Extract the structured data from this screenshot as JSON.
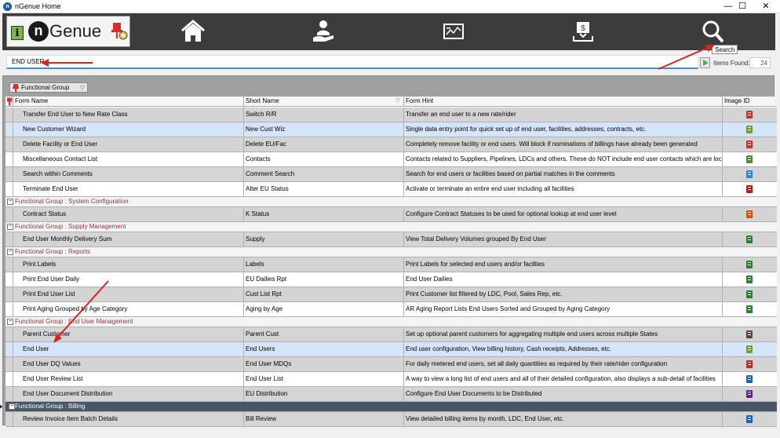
{
  "window": {
    "title": "nGenue Home",
    "minimize": "—",
    "maximize": "☐",
    "close": "✕"
  },
  "brand": {
    "info": "i",
    "logo_mark": "n",
    "logo_text": "Genue"
  },
  "nav": [
    {
      "name": "home-icon"
    },
    {
      "name": "customer-service-icon"
    },
    {
      "name": "dashboard-icon"
    },
    {
      "name": "billing-icon"
    },
    {
      "name": "search-icon"
    }
  ],
  "tooltip": "Search",
  "search": {
    "value": "END USER",
    "items_label": "Items Found:",
    "items_count": "24"
  },
  "group_chip": {
    "label": "Functional Group"
  },
  "columns": {
    "form_name": "Form Name",
    "short_name": "Short Name",
    "form_hint": "Form Hint",
    "image_id": "Image ID"
  },
  "rows": [
    {
      "type": "data",
      "form": "Transfer End User to New Rate Class",
      "short": "Switch R/R",
      "hint": "Transfer an end user to a new rate/rider",
      "icon": "transfer-icon",
      "color": "#c0392b"
    },
    {
      "type": "data",
      "form": "New Customer Wizard",
      "short": "New Cust Wiz",
      "hint": "Single data entry point for quick set up of end user, facilities, addresses, contracts, etc.",
      "icon": "users-icon",
      "color": "#7a9a3a"
    },
    {
      "type": "data",
      "form": "Delete Facility or End User",
      "short": "Delete EU/Fac",
      "hint": "Completely remove facility or end users. Will block if nominations of billings have already been generated",
      "icon": "trash-icon",
      "color": "#d32f2f"
    },
    {
      "type": "data",
      "form": "Miscellaneous Contact List",
      "short": "Contacts",
      "hint": "Contacts related to Suppliers, Pipelines, LDCs and others. These do NOT include end user contacts which are locate",
      "icon": "contacts-icon",
      "color": "#558b2f"
    },
    {
      "type": "data",
      "form": "Search within Comments",
      "short": "Comment Search",
      "hint": "Search for end users or facilities based on partial matches in the comments",
      "icon": "magnifier-icon",
      "color": "#1e88e5"
    },
    {
      "type": "data",
      "form": "Terminate End User",
      "short": "Alter EU Status",
      "hint": "Activate or terminate an entire end user including all facilities",
      "icon": "terminate-icon",
      "color": "#b71c1c"
    },
    {
      "type": "group",
      "label": "Functional Group : System Configuration"
    },
    {
      "type": "data",
      "form": "Contract Status",
      "short": "K Status",
      "hint": "Configure Contract Statuses to be used for optional lookup at end user level",
      "icon": "contract-icon",
      "color": "#e65100"
    },
    {
      "type": "group",
      "label": "Functional Group : Supply Management"
    },
    {
      "type": "data",
      "form": "End User Monthly Delivery Sum",
      "short": "Supply",
      "hint": "View Total Delivery Volumes grouped By End User",
      "icon": "report-icon",
      "color": "#2e7d32"
    },
    {
      "type": "group",
      "label": "Functional Group : Reports"
    },
    {
      "type": "data",
      "form": "Print Labels",
      "short": "Labels",
      "hint": "Print Labels for selected end users and/or facilties",
      "icon": "report-icon",
      "color": "#2e7d32"
    },
    {
      "type": "data",
      "form": "Print End User Daily",
      "short": "EU Dailies Rpt",
      "hint": "End User Dailies",
      "icon": "report-icon",
      "color": "#2e7d32"
    },
    {
      "type": "data",
      "form": "Print End User List",
      "short": "Cust List Rpt",
      "hint": "Print Customer list filtered by LDC, Pool, Sales Rep, etc.",
      "icon": "report-icon",
      "color": "#2e7d32"
    },
    {
      "type": "data",
      "form": "Print Aging Grouped by Age Category",
      "short": "Aging by Age",
      "hint": "AR Aging Report Lists End Users Sorted and Grouped by Aging Category",
      "icon": "report-icon",
      "color": "#2e7d32"
    },
    {
      "type": "group",
      "label": "Functional Group : End User Management"
    },
    {
      "type": "data",
      "form": "Parent Customer",
      "short": "Parent Cust",
      "hint": "Set up optional parent customers for aggregating multiple end users across multiple States",
      "icon": "hierarchy-icon",
      "color": "#5d4037"
    },
    {
      "type": "data",
      "form": "End User",
      "short": "End Users",
      "hint": "End user configuration, View billing history, Cash receipts, Addresses, etc.",
      "icon": "users-icon",
      "color": "#7a9a3a",
      "selected": true
    },
    {
      "type": "data",
      "form": "End User DQ Values",
      "short": "End User MDQs",
      "hint": "For daily metered end users, set all daily quantities as required by their rate/rider configuration",
      "icon": "users-edit-icon",
      "color": "#c62828"
    },
    {
      "type": "data",
      "form": "End User Review List",
      "short": "End User List",
      "hint": "A way to view a long list of end users and all of their detailed configuration, also displays a sub-detail of facilities",
      "icon": "users-list-icon",
      "color": "#1565c0"
    },
    {
      "type": "data",
      "form": "End User Document Distribution",
      "short": "EU Distribution",
      "hint": "Configure End User Documents to be Distributed",
      "icon": "users-docs-icon",
      "color": "#6a1b9a"
    },
    {
      "type": "group",
      "label": "Functional Group : Billing",
      "dark": true
    },
    {
      "type": "data",
      "form": "Review Invoice Item Batch Details",
      "short": "Bill Review",
      "hint": "View detailed billing items by month, LDC, End User, etc.",
      "icon": "invoice-icon",
      "color": "#1565c0"
    }
  ]
}
